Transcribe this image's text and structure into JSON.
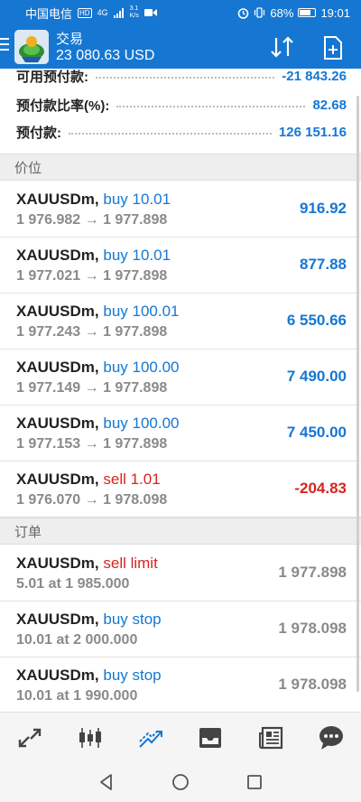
{
  "status_bar": {
    "carrier": "中国电信",
    "hd_badge": "HD",
    "network": "4G",
    "speed_value": "3.1",
    "speed_unit": "K/s",
    "battery": "68%",
    "time": "19:01"
  },
  "app_bar": {
    "title": "交易",
    "balance": "23 080.63 USD"
  },
  "account": [
    {
      "label": "可用预付款:",
      "value": "-21 843.26"
    },
    {
      "label": "预付款比率(%):",
      "value": "82.68"
    },
    {
      "label": "预付款:",
      "value": "126 151.16"
    }
  ],
  "positions_header": "价位",
  "positions": [
    {
      "symbol": "XAUUSDm,",
      "side": "buy 10.01",
      "side_type": "buy",
      "prices": "1 976.982 → 1 977.898",
      "profit": "916.92",
      "profit_sign": "pos"
    },
    {
      "symbol": "XAUUSDm,",
      "side": "buy 10.01",
      "side_type": "buy",
      "prices": "1 977.021 → 1 977.898",
      "profit": "877.88",
      "profit_sign": "pos"
    },
    {
      "symbol": "XAUUSDm,",
      "side": "buy 100.01",
      "side_type": "buy",
      "prices": "1 977.243 → 1 977.898",
      "profit": "6 550.66",
      "profit_sign": "pos"
    },
    {
      "symbol": "XAUUSDm,",
      "side": "buy 100.00",
      "side_type": "buy",
      "prices": "1 977.149 → 1 977.898",
      "profit": "7 490.00",
      "profit_sign": "pos"
    },
    {
      "symbol": "XAUUSDm,",
      "side": "buy 100.00",
      "side_type": "buy",
      "prices": "1 977.153 → 1 977.898",
      "profit": "7 450.00",
      "profit_sign": "pos"
    },
    {
      "symbol": "XAUUSDm,",
      "side": "sell 1.01",
      "side_type": "sell",
      "prices": "1 976.070 → 1 978.098",
      "profit": "-204.83",
      "profit_sign": "neg"
    }
  ],
  "orders_header": "订单",
  "orders": [
    {
      "symbol": "XAUUSDm,",
      "side": "sell limit",
      "side_type": "sell",
      "detail": "5.01 at 1 985.000",
      "price": "1 977.898"
    },
    {
      "symbol": "XAUUSDm,",
      "side": "buy stop",
      "side_type": "buy",
      "detail": "10.01 at 2 000.000",
      "price": "1 978.098"
    },
    {
      "symbol": "XAUUSDm,",
      "side": "buy stop",
      "side_type": "buy",
      "detail": "10.01 at 1 990.000",
      "price": "1 978.098"
    }
  ],
  "bottom_nav": {
    "tabs": [
      "quotes-icon",
      "chart-icon",
      "trade-icon",
      "history-icon",
      "news-icon",
      "chat-icon"
    ],
    "active_index": 2,
    "active_color": "#1677d2",
    "inactive_color": "#444444"
  },
  "colors": {
    "brand": "#1677d2",
    "positive": "#1677d2",
    "negative": "#d8241e"
  }
}
